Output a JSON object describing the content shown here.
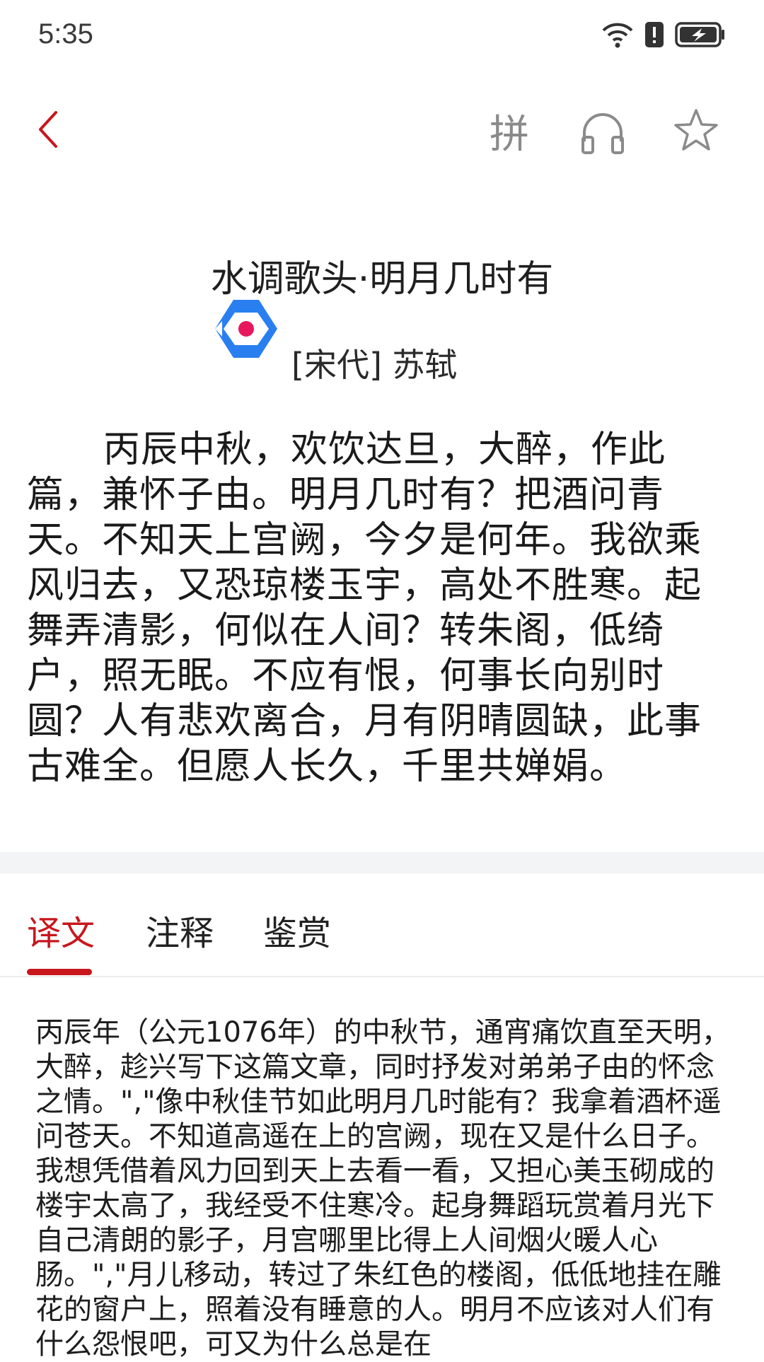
{
  "status_bar": {
    "time": "5:35",
    "icons": [
      "wifi-icon",
      "alert-icon",
      "battery-charging-icon"
    ]
  },
  "toolbar": {
    "back_icon": "back-chevron-icon",
    "pinyin_label": "拼",
    "audio_icon": "headphones-icon",
    "favorite_icon": "star-icon",
    "accent_color": "#c8161d"
  },
  "poem": {
    "title": "水调歌头·明月几时有",
    "author": "[宋代] 苏轼",
    "body": "丙辰中秋，欢饮达旦，大醉，作此篇，兼怀子由。明月几时有？把酒问青天。不知天上宫阙，今夕是何年。我欲乘风归去，又恐琼楼玉宇，高处不胜寒。起舞弄清影，何似在人间？转朱阁，低绮户，照无眠。不应有恨，何事长向别时圆？人有悲欢离合，月有阴晴圆缺，此事古难全。但愿人长久，千里共婵娟。"
  },
  "tabs": {
    "active_index": 0,
    "items": [
      {
        "label": "译文"
      },
      {
        "label": "注释"
      },
      {
        "label": "鉴赏"
      }
    ]
  },
  "translation": {
    "text": "丙辰年（公元1076年）的中秋节，通宵痛饮直至天明，大醉，趁兴写下这篇文章，同时抒发对弟弟子由的怀念之情。\",\"像中秋佳节如此明月几时能有？我拿着酒杯遥问苍天。不知道高遥在上的宫阙，现在又是什么日子。我想凭借着风力回到天上去看一看，又担心美玉砌成的楼宇太高了，我经受不住寒冷。起身舞蹈玩赏着月光下自己清朗的影子，月宫哪里比得上人间烟火暖人心肠。\",\"月儿移动，转过了朱红色的楼阁，低低地挂在雕花的窗户上，照着没有睡意的人。明月不应该对人们有什么怨恨吧，可又为什么总是在"
  }
}
